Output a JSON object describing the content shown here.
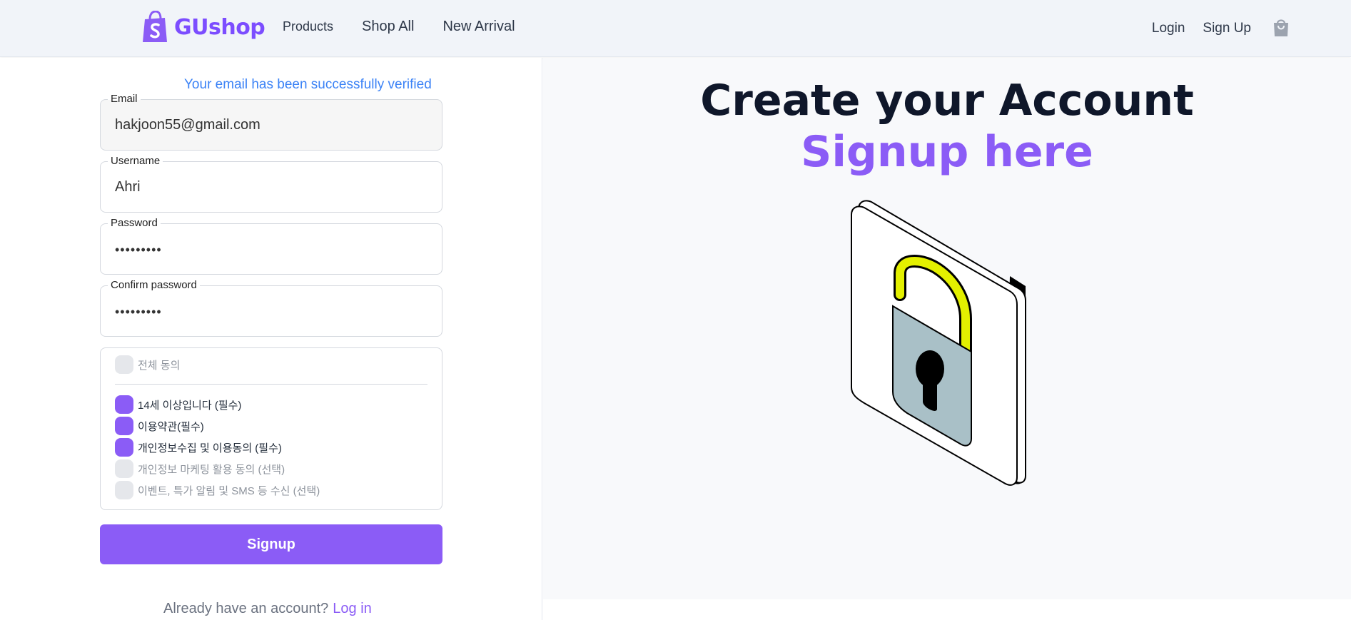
{
  "header": {
    "brand": "GUshop",
    "nav": [
      "Products",
      "Shop All",
      "New Arrival"
    ],
    "auth": [
      "Login",
      "Sign Up"
    ],
    "icons": [
      "shopify-bag-icon",
      "shopping-bag-icon"
    ],
    "brand_color": "#7c4dff"
  },
  "form": {
    "verified_message": "Your email has been successfully verified",
    "email": {
      "label": "Email",
      "value": "hakjoon55@gmail.com"
    },
    "username": {
      "label": "Username",
      "value": "Ahri"
    },
    "password": {
      "label": "Password",
      "value": "•••••••••"
    },
    "confirm_password": {
      "label": "Confirm password",
      "value": "•••••••••"
    },
    "terms": {
      "all": {
        "label": "전체 동의",
        "checked": false
      },
      "items": [
        {
          "label": "14세 이상입니다 (필수)",
          "checked": true
        },
        {
          "label": "이용약관(필수)",
          "checked": true
        },
        {
          "label": "개인정보수집 및 이용동의 (필수)",
          "checked": true
        },
        {
          "label": "개인정보 마케팅 활용 동의 (선택)",
          "checked": false
        },
        {
          "label": "이벤트, 특가 알림 및 SMS 등 수신 (선택)",
          "checked": false
        }
      ]
    },
    "submit_label": "Signup",
    "footer_text": "Already have an account?",
    "footer_link": "Log in",
    "accent_color": "#8b5cf6",
    "link_color": "#3b82f6"
  },
  "hero": {
    "title": "Create your Account",
    "subtitle": "Signup here",
    "illustration": "unlocked-padlock-icon"
  }
}
